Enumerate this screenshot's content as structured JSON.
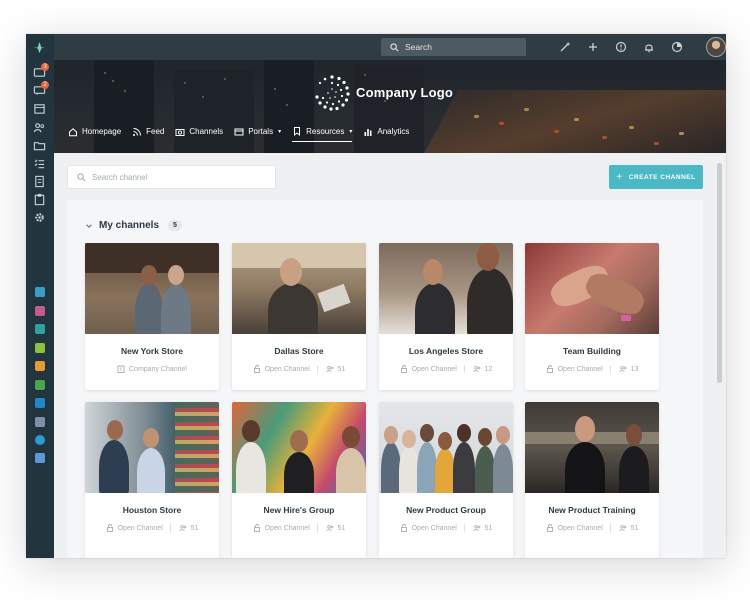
{
  "topbar": {
    "search_placeholder": "Search",
    "icons": [
      "wand-icon",
      "plus-icon",
      "alert-circle-icon",
      "bell-icon",
      "pie-chart-icon"
    ]
  },
  "hero": {
    "company_name": "Company Logo",
    "nav": [
      {
        "label": "Homepage",
        "icon": "home-icon"
      },
      {
        "label": "Feed",
        "icon": "rss-icon"
      },
      {
        "label": "Channels",
        "icon": "camera-icon"
      },
      {
        "label": "Portals",
        "icon": "card-icon",
        "caret": "▾"
      },
      {
        "label": "Resources",
        "icon": "bookmark-icon",
        "caret": "▾",
        "active": true
      },
      {
        "label": "Analytics",
        "icon": "bar-chart-icon"
      }
    ]
  },
  "rail": {
    "badges": [
      "3",
      "2"
    ]
  },
  "content": {
    "search_placeholder": "Search channel",
    "create_label": "CREATE CHANNEL",
    "section_title": "My channels",
    "section_count": "5",
    "channels": [
      {
        "title": "New York Store",
        "type": "Company Channel",
        "members": ""
      },
      {
        "title": "Dallas Store",
        "type": "Open Channel",
        "sep": "|",
        "members": "51"
      },
      {
        "title": "Los Angeles Store",
        "type": "Open Channel",
        "sep": "|",
        "members": "12"
      },
      {
        "title": "Team Building",
        "type": "Open Channel",
        "sep": "|",
        "members": "13"
      },
      {
        "title": "Houston Store",
        "type": "Open Channel",
        "sep": "|",
        "members": "51"
      },
      {
        "title": "New Hire's Group",
        "type": "Open Channel",
        "sep": "|",
        "members": "51"
      },
      {
        "title": "New Product Group",
        "type": "Open Channel",
        "sep": "|",
        "members": "51"
      },
      {
        "title": "New Product Training",
        "type": "Open Channel",
        "sep": "|",
        "members": "51"
      }
    ]
  },
  "colors": {
    "accent": "#4bb8c5",
    "rail": "#22343d",
    "topbar": "#2f3c44",
    "badge": "#e8613b"
  }
}
